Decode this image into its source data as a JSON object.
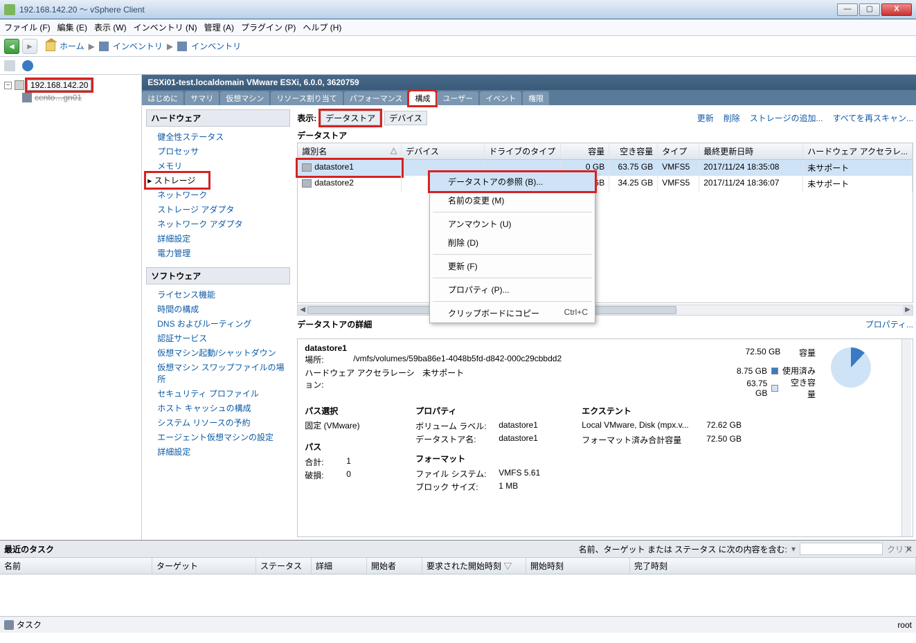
{
  "window": {
    "title": "192.168.142.20 ～ vSphere Client"
  },
  "menu": {
    "file": "ファイル (F)",
    "edit": "編集 (E)",
    "view": "表示 (W)",
    "inventory": "インベントリ (N)",
    "admin": "管理 (A)",
    "plugins": "プラグイン (P)",
    "help": "ヘルプ (H)"
  },
  "breadcrumb": {
    "home": "ホーム",
    "inv1": "インベントリ",
    "inv2": "インベントリ"
  },
  "tree": {
    "host": "192.168.142.20",
    "child": "cento…gn01"
  },
  "host_header": "ESXi01-test.localdomain VMware ESXi, 6.0.0, 3620759",
  "tabs": {
    "t0": "はじめに",
    "t1": "サマリ",
    "t2": "仮想マシン",
    "t3": "リソース割り当て",
    "t4": "パフォーマンス",
    "t5": "構成",
    "t6": "ユーザー",
    "t7": "イベント",
    "t8": "権限"
  },
  "hardware": {
    "title": "ハードウェア",
    "health": "健全性ステータス",
    "cpu": "プロセッサ",
    "mem": "メモリ",
    "storage": "ストレージ",
    "net": "ネットワーク",
    "sadapter": "ストレージ アダプタ",
    "nadapter": "ネットワーク アダプタ",
    "adv": "詳細設定",
    "power": "電力管理"
  },
  "software": {
    "title": "ソフトウェア",
    "lic": "ライセンス機能",
    "time": "時間の構成",
    "dns": "DNS およびルーティング",
    "auth": "認証サービス",
    "vmstart": "仮想マシン起動/シャットダウン",
    "swap": "仮想マシン スワップファイルの場所",
    "sec": "セキュリティ プロファイル",
    "cache": "ホスト キャッシュの構成",
    "res": "システム リソースの予約",
    "agent": "エージェント仮想マシンの設定",
    "adv": "詳細設定"
  },
  "view": {
    "label": "表示:",
    "ds": "データストア",
    "dev": "デバイス"
  },
  "actions": {
    "refresh": "更新",
    "delete": "削除",
    "add": "ストレージの追加...",
    "rescan": "すべてを再スキャン..."
  },
  "ds_section": "データストア",
  "grid_hdr": {
    "id": "識別名",
    "dev": "デバイス",
    "drv": "ドライブのタイプ",
    "cap": "容量",
    "free": "空き容量",
    "type": "タイプ",
    "upd": "最終更新日時",
    "hw": "ハードウェア アクセラレ..."
  },
  "rows": [
    {
      "id": "datastore1",
      "dev": "",
      "drv": "",
      "cap": "0 GB",
      "free": "63.75 GB",
      "type": "VMFS5",
      "upd": "2017/11/24 18:35:08",
      "hw": "未サポート"
    },
    {
      "id": "datastore2",
      "dev": "",
      "drv": "",
      "cap": "5 GB",
      "free": "34.25 GB",
      "type": "VMFS5",
      "upd": "2017/11/24 18:36:07",
      "hw": "未サポート"
    }
  ],
  "ctx": {
    "browse": "データストアの参照 (B)...",
    "rename": "名前の変更 (M)",
    "unmount": "アンマウント (U)",
    "delete": "削除 (D)",
    "refresh": "更新 (F)",
    "props": "プロパティ (P)...",
    "clip": "クリップボードにコピー",
    "clip_sc": "Ctrl+C"
  },
  "detail": {
    "title": "データストアの詳細",
    "propsLink": "プロパティ...",
    "name": "datastore1",
    "loc_k": "場所:",
    "loc_v": "/vmfs/volumes/59ba86e1-4048b5fd-d842-000c29cbbdd2",
    "hw_k": "ハードウェア アクセラレーション:",
    "hw_v": "未サポート",
    "cap_v": "72.50 GB",
    "cap_l": "容量",
    "used_v": "8.75 GB",
    "used_l": "使用済み",
    "free_v": "63.75 GB",
    "free_l": "空き容量",
    "pathSel_h": "パス選択",
    "pathSel_v": "固定 (VMware)",
    "path_h": "パス",
    "total": "合計:",
    "total_v": "1",
    "broken": "破損:",
    "broken_v": "0",
    "props_h": "プロパティ",
    "vol": "ボリューム ラベル:",
    "vol_v": "datastore1",
    "dsname": "データストア名:",
    "dsname_v": "datastore1",
    "fmt_h": "フォーマット",
    "fs": "ファイル システム:",
    "fs_v": "VMFS 5.61",
    "blk": "ブロック サイズ:",
    "blk_v": "1 MB",
    "ext_h": "エクステント",
    "ext_k": "Local VMware, Disk (mpx.v...",
    "ext_v": "72.62 GB",
    "fmtcap": "フォーマット済み合計容量",
    "fmtcap_v": "72.50 GB"
  },
  "tasks": {
    "title": "最近のタスク",
    "filter": "名前、ターゲット または ステータス に次の内容を含む:",
    "clear": "クリア",
    "c_name": "名前",
    "c_tgt": "ターゲット",
    "c_st": "ステータス",
    "c_det": "詳細",
    "c_ini": "開始者",
    "c_rq": "要求された開始時刻",
    "c_start": "開始時刻",
    "c_end": "完了時刻"
  },
  "status": {
    "tasks": "タスク",
    "user": "root"
  }
}
